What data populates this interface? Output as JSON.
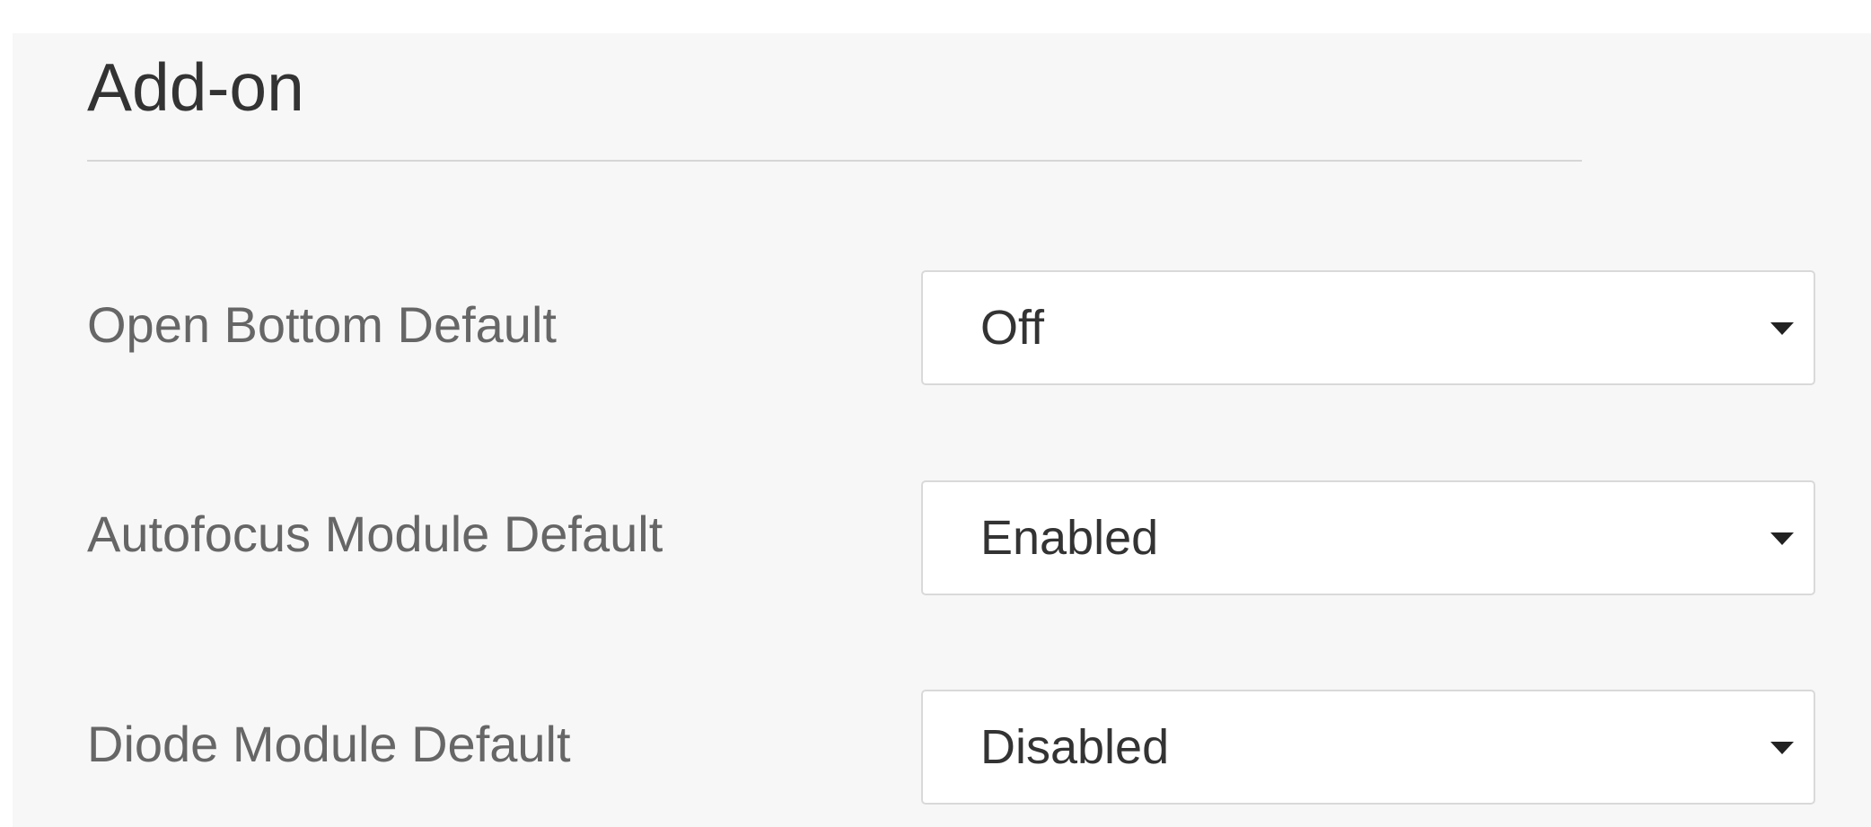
{
  "section": {
    "title": "Add-on"
  },
  "settings": [
    {
      "label": "Open Bottom Default",
      "value": "Off",
      "icon": "caret-down-icon"
    },
    {
      "label": "Autofocus Module Default",
      "value": "Enabled",
      "icon": "caret-down-icon"
    },
    {
      "label": "Diode Module Default",
      "value": "Disabled",
      "icon": "caret-down-icon"
    }
  ]
}
